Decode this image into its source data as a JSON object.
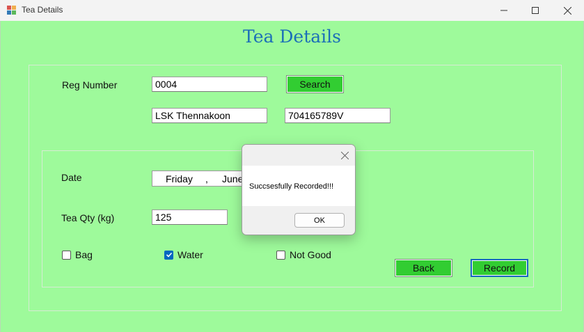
{
  "window": {
    "title": "Tea Details",
    "icon": "app-form-icon",
    "controls": {
      "minimize": "minimize-icon",
      "maximize": "maximize-icon",
      "close": "close-icon"
    }
  },
  "form": {
    "heading": "Tea Details",
    "reg_number_label": "Reg Number",
    "reg_number_value": "0004",
    "search_label": "Search",
    "name_value": "LSK Thennakoon",
    "nic_value": "704165789V",
    "date_label": "Date",
    "date_day": "Friday",
    "date_sep": ",",
    "date_month": "June",
    "tea_qty_label": "Tea Qty (kg)",
    "tea_qty_value": "125",
    "checkboxes": [
      {
        "label": "Bag",
        "checked": false
      },
      {
        "label": "Water",
        "checked": true
      },
      {
        "label": "Not Good",
        "checked": false
      }
    ],
    "back_label": "Back",
    "record_label": "Record"
  },
  "dialog": {
    "message": "Succsesfully Recorded!!!",
    "ok_label": "OK"
  },
  "colors": {
    "background": "#9efa9b",
    "button": "#32cd32",
    "heading": "#1b6fb8",
    "checkbox_checked": "#0067c0"
  }
}
